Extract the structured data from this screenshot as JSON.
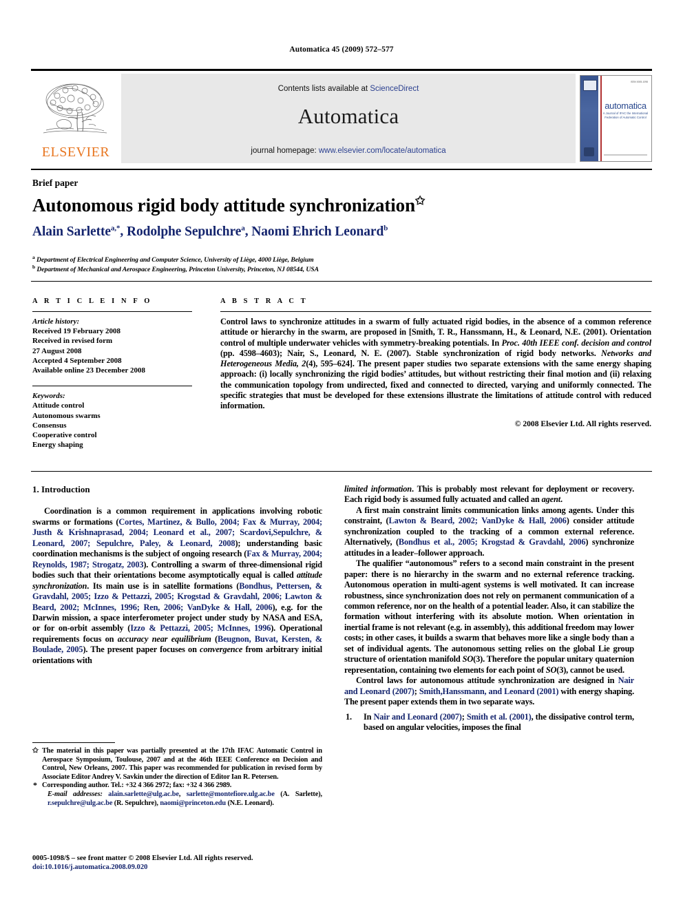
{
  "running_head": "Automatica 45 (2009) 572–577",
  "masthead": {
    "publisher_name": "ELSEVIER",
    "contents_prefix": "Contents lists available at ",
    "contents_link": "ScienceDirect",
    "journal_title": "Automatica",
    "homepage_prefix": "journal homepage: ",
    "homepage_link": "www.elsevier.com/locate/automatica",
    "cover": {
      "wordmark": "automatica",
      "subtitle": "A Journal of IFAC the International Federation of Automatic Control",
      "corner_note": "ISSN 0005-1098"
    }
  },
  "article": {
    "type_label": "Brief paper",
    "title": "Autonomous rigid body attitude synchronization",
    "title_marker": "✩",
    "authors": [
      {
        "name": "Alain Sarlette",
        "sup": "a,*"
      },
      {
        "name": "Rodolphe Sepulchre",
        "sup": "a"
      },
      {
        "name": "Naomi Ehrich Leonard",
        "sup": "b"
      }
    ],
    "affiliations": [
      {
        "mark": "a",
        "text": "Department of Electrical Engineering and Computer Science, University of Liège, 4000 Liège, Belgium"
      },
      {
        "mark": "b",
        "text": "Department of Mechanical and Aerospace Engineering, Princeton University, Princeton, NJ 08544, USA"
      }
    ]
  },
  "info": {
    "heading": "A R T I C L E   I N F O",
    "history_label": "Article history:",
    "history": [
      "Received 19 February 2008",
      "Received in revised form",
      "27 August 2008",
      "Accepted 4 September 2008",
      "Available online 23 December 2008"
    ],
    "keywords_label": "Keywords:",
    "keywords": [
      "Attitude control",
      "Autonomous swarms",
      "Consensus",
      "Cooperative control",
      "Energy shaping"
    ]
  },
  "abstract": {
    "heading": "A B S T R A C T",
    "p1_a": "Control laws to synchronize attitudes in a swarm of fully actuated rigid bodies, in the absence of a common reference attitude or hierarchy in the swarm, are proposed in [Smith, T. R., Hanssmann, H., & Leonard, N.E. (2001). Orientation control of multiple underwater vehicles with symmetry-breaking potentials. In ",
    "p1_i1": "Proc. 40th IEEE conf. decision and control",
    "p1_b": " (pp. 4598–4603); Nair, S., Leonard, N. E. (2007). Stable synchronization of rigid body networks. ",
    "p1_i2": "Networks and Heterogeneous Media, 2",
    "p1_c": "(4), 595–624]. The present paper studies two separate extensions with the same energy shaping approach: (i) locally synchronizing the rigid bodies’ attitudes, but without restricting their final motion and (ii) relaxing the communication topology from undirected, fixed and connected to directed, varying and uniformly connected. The specific strategies that must be developed for these extensions illustrate the limitations of attitude control with reduced information.",
    "copyright": "© 2008 Elsevier Ltd. All rights reserved."
  },
  "body": {
    "section_heading": "1. Introduction",
    "left": {
      "p1_a": "Coordination is a common requirement in applications involving robotic swarms or formations (",
      "p1_c1": "Cortes, Martinez, & Bullo, 2004; Fax & Murray, 2004; Justh & Krishnaprasad, 2004; Leonard et al., 2007; Scardovi,Sepulchre, & Leonard, 2007; Sepulchre, Paley, & Leonard, 2008",
      "p1_b": "); understanding basic coordination mechanisms is the subject of ongoing research (",
      "p1_c2": "Fax & Murray, 2004; Reynolds, 1987; Strogatz, 2003",
      "p1_c_txt": "). Controlling a swarm of three-dimensional rigid bodies such that their orientations become asymptotically equal is called ",
      "p1_i1": "attitude synchronization",
      "p1_d": ". Its main use is in satellite formations (",
      "p1_c3": "Bondhus, Pettersen, & Gravdahl, 2005; Izzo & Pettazzi, 2005; Krogstad & Gravdahl, 2006; Lawton & Beard, 2002; McInnes, 1996; Ren, 2006; VanDyke & Hall, 2006",
      "p1_e": "), e.g. for the Darwin mission, a space interferometer project under study by NASA and ESA, or for on-orbit assembly (",
      "p1_c4": "Izzo & Pettazzi, 2005; McInnes, 1996",
      "p1_f": "). Operational requirements focus on ",
      "p1_i2": "accuracy near equilibrium",
      "p1_g": " (",
      "p1_c5": "Beugnon, Buvat, Kersten, & Boulade, 2005",
      "p1_h": "). The present paper focuses on ",
      "p1_i3": "convergence",
      "p1_i": " from arbitrary initial orientations with"
    },
    "right": {
      "p1_i1": "limited information",
      "p1_a": ". This is probably most relevant for deployment or recovery. Each rigid body is assumed fully actuated and called an ",
      "p1_i2": "agent",
      "p1_b": ".",
      "p2_a": "A first main constraint limits communication links among agents. Under this constraint, (",
      "p2_c1": "Lawton & Beard, 2002; VanDyke & Hall, 2006",
      "p2_b": ") consider attitude synchronization coupled to the tracking of a common external reference. Alternatively, (",
      "p2_c2": "Bondhus et al., 2005; Krogstad & Gravdahl, 2006",
      "p2_c": ") synchronize attitudes in a leader–follower approach.",
      "p3_a": "The qualifier “autonomous” refers to a second main constraint in the present paper: there is no hierarchy in the swarm and no external reference tracking. Autonomous operation in multi-agent systems is well motivated. It can increase robustness, since synchronization does not rely on permanent communication of a common reference, nor on the health of a potential leader. Also, it can stabilize the formation without interfering with its absolute motion. When orientation in inertial frame is not relevant (e.g. in assembly), this additional freedom may lower costs; in other cases, it builds a swarm that behaves more like a single body than a set of individual agents. The autonomous setting relies on the global Lie group structure of orientation manifold ",
      "p3_i1": "SO",
      "p3_b": "(3). Therefore the popular unitary quaternion representation, containing two elements for each point of ",
      "p3_i2": "SO",
      "p3_c": "(3), cannot be used.",
      "p4_a": "Control laws for autonomous attitude synchronization are designed in ",
      "p4_c1": "Nair and Leonard (2007)",
      "p4_b": "; ",
      "p4_c2": "Smith,Hanssmann, and Leonard (2001)",
      "p4_c": " with energy shaping. The present paper extends them in two separate ways.",
      "item1_num": "1.",
      "item1_a": "In ",
      "item1_c1": "Nair and Leonard (2007)",
      "item1_b": "; ",
      "item1_c2": "Smith et al. (2001)",
      "item1_c": ", the dissipative control term, based on angular velocities, imposes the final"
    }
  },
  "footnotes": {
    "star_mark": "✩",
    "star_text": "The material in this paper was partially presented at the 17th IFAC Automatic Control in Aerospace Symposium, Toulouse, 2007 and at the 46th IEEE Conference on Decision and Control, New Orleans, 2007. This paper was recommended for publication in revised form by Associate Editor Andrey V. Savkin under the direction of Editor Ian R. Petersen.",
    "corr_mark": "*",
    "corr_text": "Corresponding author. Tel.: +32 4 366 2972; fax: +32 4 366 2989.",
    "email_label": "E-mail addresses:",
    "email_1": "alain.sarlette@ulg.ac.be",
    "email_sep1": ", ",
    "email_2": "sarlette@montefiore.ulg.ac.be",
    "email_owner1": " (A. Sarlette), ",
    "email_3": "r.sepulchre@ulg.ac.be",
    "email_owner2": " (R. Sepulchre), ",
    "email_4": "naomi@princeton.edu",
    "email_owner3": " (N.E. Leonard)."
  },
  "imprint": {
    "issn_line": "0005-1098/$ – see front matter © 2008 Elsevier Ltd. All rights reserved.",
    "doi_label": "doi:",
    "doi_value": "10.1016/j.automatica.2008.09.020"
  }
}
